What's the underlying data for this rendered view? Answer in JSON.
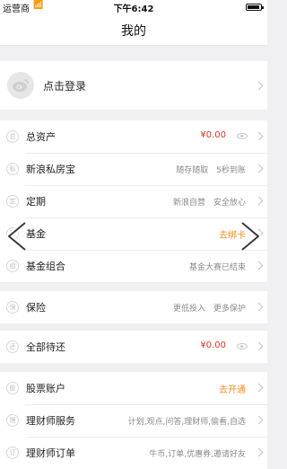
{
  "status_bar": {
    "carrier": "运营商",
    "wifi": "WiFi",
    "time": "下午6:42"
  },
  "nav": {
    "title": "我的"
  },
  "login": {
    "label": "点击登录"
  },
  "assets_group": [
    {
      "icon": "总",
      "label": "总资产",
      "detail": "¥0.00",
      "style": "red",
      "eye": true
    },
    {
      "icon": "私",
      "label": "新浪私房宝",
      "detail": "随存随取　5秒到账",
      "style": "gray"
    },
    {
      "icon": "定",
      "label": "定期",
      "detail": "新浪自营　安全放心",
      "style": "gray"
    },
    {
      "icon": "基",
      "label": "基金",
      "detail": "去绑卡",
      "style": "orange"
    },
    {
      "icon": "组",
      "label": "基金组合",
      "detail": "基金大赛已结束",
      "style": "gray"
    }
  ],
  "insurance_group": [
    {
      "icon": "保",
      "label": "保险",
      "detail": "更低投入　更多保护",
      "style": "gray"
    }
  ],
  "repay_group": [
    {
      "icon": "还",
      "label": "全部待还",
      "detail": "¥0.00",
      "style": "red",
      "eye": true
    }
  ],
  "stock_group": [
    {
      "icon": "股",
      "label": "股票账户",
      "detail": "去开通",
      "style": "orange"
    },
    {
      "icon": "理",
      "label": "理财师服务",
      "detail": "计划,观点,问答,理财师,偷看,自选",
      "style": "gray"
    },
    {
      "icon": "订",
      "label": "理财师订单",
      "detail": "牛币,订单,优惠券,邀请好友",
      "style": "gray"
    }
  ],
  "colors": {
    "accent_red": "#d9362b",
    "accent_orange": "#f08c1a"
  },
  "icons": {
    "prev": "chevron-left-icon",
    "next": "chevron-right-icon",
    "avatar": "weibo-logo-icon"
  }
}
